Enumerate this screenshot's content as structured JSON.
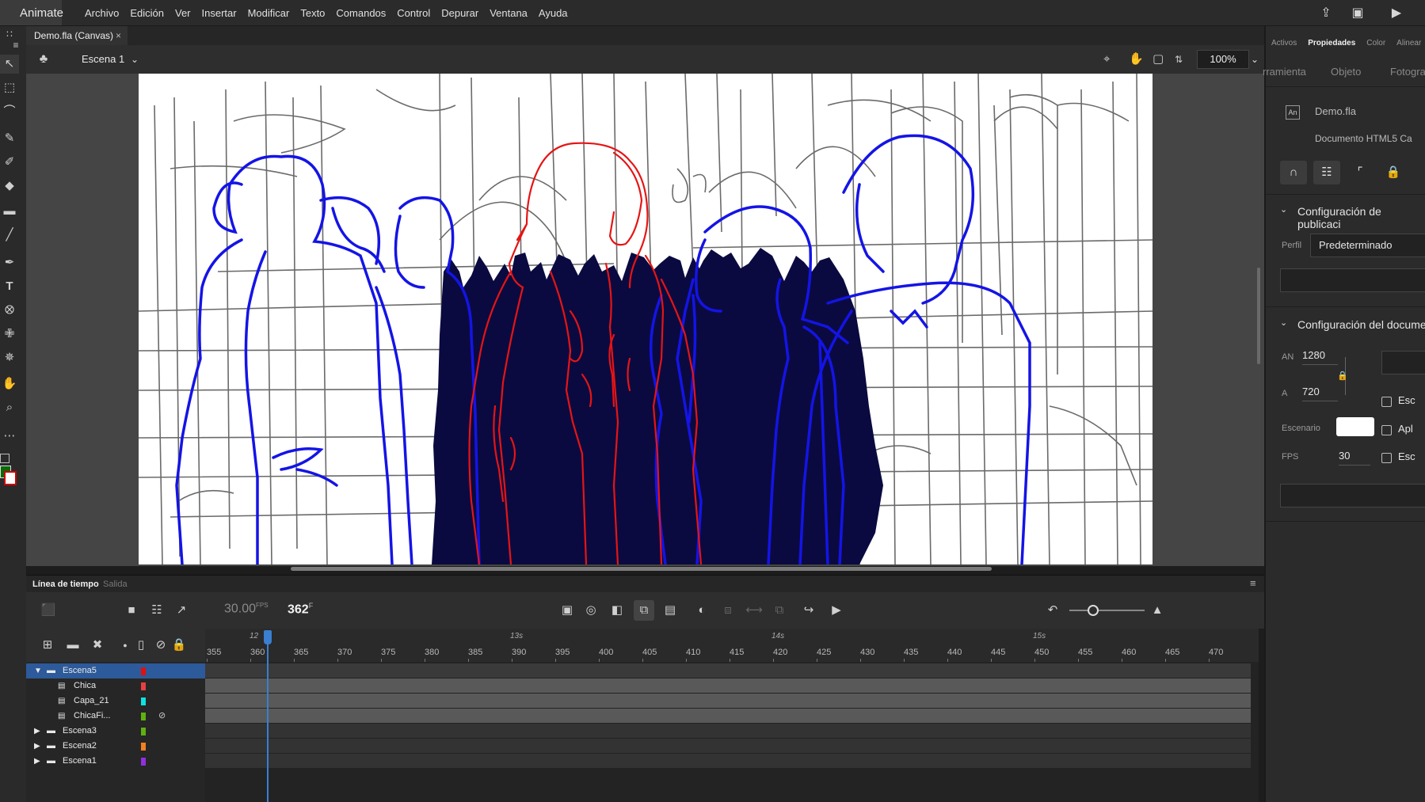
{
  "app": {
    "name": "Animate"
  },
  "menu": [
    "Archivo",
    "Edición",
    "Ver",
    "Insertar",
    "Modificar",
    "Texto",
    "Comandos",
    "Control",
    "Depurar",
    "Ventana",
    "Ayuda"
  ],
  "document": {
    "tab_title": "Demo.fla (Canvas)",
    "close_glyph": "×"
  },
  "scene": {
    "label": "Escena 1",
    "zoom": "100%"
  },
  "timeline": {
    "tabs": [
      "Línea de tiempo",
      "Salida"
    ],
    "fps": "30.00",
    "fps_unit": "FPS",
    "current_frame": "362",
    "frame_unit": "F",
    "frame_numbers": [
      "355",
      "360",
      "365",
      "370",
      "375",
      "380",
      "385",
      "390",
      "395",
      "400",
      "405",
      "410",
      "415",
      "420",
      "425",
      "430",
      "435",
      "440",
      "445",
      "450",
      "455",
      "460",
      "465",
      "470"
    ],
    "seconds_labels": [
      "12",
      "13s",
      "14s",
      "15s"
    ],
    "layers": [
      {
        "name": "Escena5",
        "type": "folder",
        "expanded": true,
        "color": "#e01010",
        "selected": true
      },
      {
        "name": "Chica",
        "type": "layer",
        "color": "#e84040"
      },
      {
        "name": "Capa_21",
        "type": "layer",
        "color": "#10e0e0"
      },
      {
        "name": "ChicaFi...",
        "type": "layer",
        "color": "#60b010",
        "hidden": true
      },
      {
        "name": "Escena3",
        "type": "folder",
        "expanded": false,
        "color": "#60b010"
      },
      {
        "name": "Escena2",
        "type": "folder",
        "expanded": false,
        "color": "#f08020"
      },
      {
        "name": "Escena1",
        "type": "folder",
        "expanded": false,
        "color": "#9030e0"
      }
    ]
  },
  "properties": {
    "tabs": [
      "Activos",
      "Propiedades",
      "Color",
      "Alinear"
    ],
    "subtabs": [
      "rramienta",
      "Objeto",
      "Fotogra"
    ],
    "file_name": "Demo.fla",
    "file_badge": "An",
    "doc_type": "Documento HTML5 Ca",
    "publish_section": "Configuración de publicaci",
    "profile_label": "Perfil",
    "profile_value": "Predeterminado",
    "document_section": "Configuración del docume",
    "width_label": "AN",
    "width_value": "1280",
    "height_label": "A",
    "height_value": "720",
    "stage_label": "Escenario",
    "fps_label": "FPS",
    "fps_value": "30",
    "checkboxes": [
      "Esc",
      "Apl",
      "Esc"
    ],
    "stage_color": "#ffffff"
  },
  "colors": {
    "accent": "#2d5a9a",
    "playhead": "#3a7fd0",
    "stroke_fill": "#0a6a0a"
  }
}
